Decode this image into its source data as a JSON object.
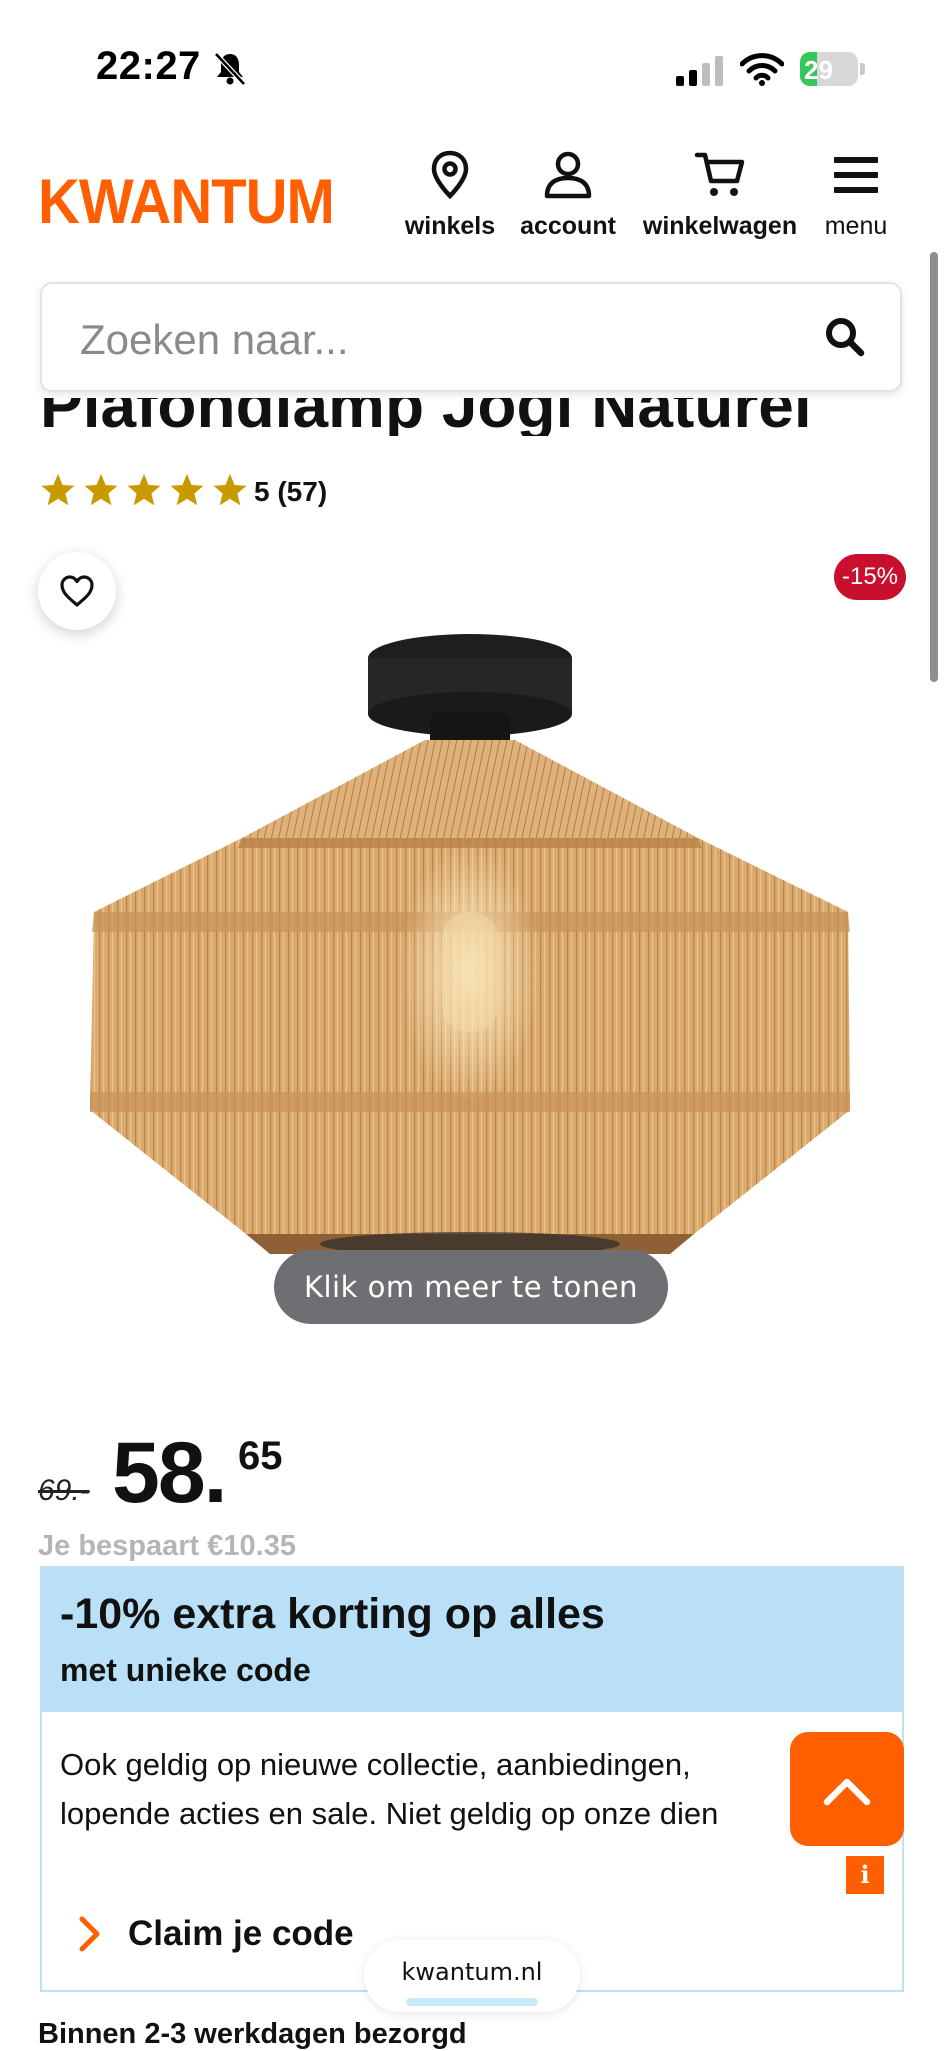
{
  "status_bar": {
    "time": "22:27",
    "battery": "29",
    "battery_level": 0.29
  },
  "header": {
    "logo": "KWANTUM",
    "nav": [
      {
        "label": "winkels",
        "icon": "location-pin-icon"
      },
      {
        "label": "account",
        "icon": "user-icon"
      },
      {
        "label": "winkelwagen",
        "icon": "cart-icon"
      },
      {
        "label": "menu",
        "icon": "hamburger-menu-icon"
      }
    ]
  },
  "search": {
    "placeholder": "Zoeken naar..."
  },
  "product": {
    "title": "Plafondlamp Jogi Naturel",
    "rating_stars": 5,
    "rating_text": "5 (57)",
    "discount_badge": "-15%",
    "more_button": "Klik om meer te tonen",
    "old_price": "69.-",
    "price_main": "58.",
    "price_cents": "65",
    "saving": "Je bespaart €10.35"
  },
  "promo": {
    "headline": "-10% extra korting op alles",
    "subheadline": "met unieke code",
    "body_line1": "Ook geldig op nieuwe collectie, aanbiedingen,",
    "body_line2": "lopende acties en sale. Niet geldig op onze dien",
    "claim_label": "Claim je code"
  },
  "floating": {
    "info_label": "i"
  },
  "browser": {
    "url": "kwantum.nl"
  },
  "delivery": "Binnen 2-3 werkdagen bezorgd",
  "colors": {
    "brand_orange": "#ff5f00",
    "discount_red": "#c8102e",
    "promo_blue": "#b9e0f7",
    "star_gold": "#c89a00"
  }
}
